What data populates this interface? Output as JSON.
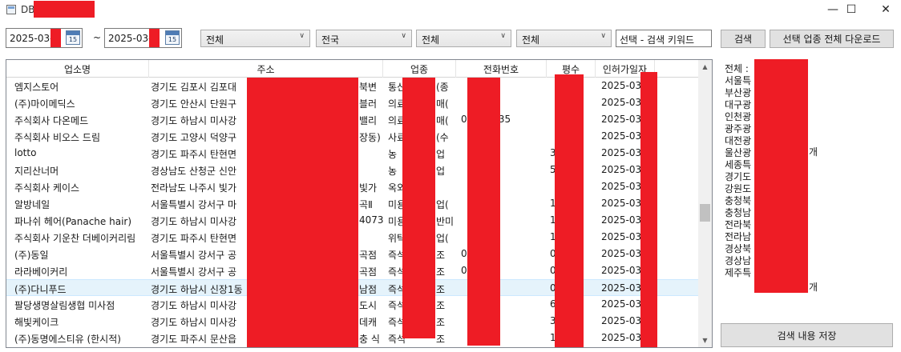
{
  "window": {
    "title": "DB",
    "minimize_glyph": "—",
    "maximize_glyph": "☐",
    "close_glyph": "✕"
  },
  "filters": {
    "date_from": "2025-03-",
    "date_to": "2025-03-",
    "date_separator": "~",
    "calendar_day": "15",
    "combo1": "전체",
    "combo2": "전국",
    "combo3": "전체",
    "combo4": "전체",
    "keyword": "선택 - 검색 키워드",
    "search_label": "검색",
    "download_label": "선택 업종 전체 다운로드"
  },
  "table": {
    "columns": [
      "업소명",
      "주소",
      "업종",
      "전화번호",
      "평수",
      "인허가일자"
    ],
    "rows": [
      {
        "name": "엠지스토어",
        "address": "경기도 김포시 김포대",
        "addr_tail": "북변",
        "type": "통신",
        "type_tail": "(종",
        "phone": "",
        "area": "",
        "date": "2025-03-"
      },
      {
        "name": "(주)마이메딕스",
        "address": "경기도 안산시 단원구",
        "addr_tail": "블러",
        "type": "의료",
        "type_tail": "매(",
        "phone": "",
        "area": "",
        "date": "2025-03-"
      },
      {
        "name": "주식회사 다온메드",
        "address": "경기도 하남시 미사강",
        "addr_tail": "밸리",
        "type": "의료",
        "type_tail": "매(",
        "phone": "02-7-6135",
        "area": "",
        "date": "2025-03-"
      },
      {
        "name": "주식회사 비오스 드림",
        "address": "경기도 고양시 덕양구",
        "addr_tail": "장동)",
        "type": "사료",
        "type_tail": "(수",
        "phone": "",
        "area": "",
        "date": "2025-03-"
      },
      {
        "name": "lotto",
        "address": "경기도 파주시 탄현면",
        "addr_tail": "",
        "type": "농",
        "type_tail": "업",
        "phone": "",
        "area": "3",
        "date": "2025-03-"
      },
      {
        "name": "지리산너머",
        "address": "경상남도 산청군 신안",
        "addr_tail": "",
        "type": "농",
        "type_tail": "업",
        "phone": "",
        "area": "5",
        "date": "2025-03-"
      },
      {
        "name": "주식회사 케이스",
        "address": "전라남도 나주시 빛가",
        "addr_tail": "빛가",
        "type": "옥외",
        "type_tail": "",
        "phone": "",
        "area": "",
        "date": "2025-03-"
      },
      {
        "name": "알방네일",
        "address": "서울특별시 강서구 마",
        "addr_tail": "곡Ⅱ",
        "type": "미용",
        "type_tail": "업(",
        "phone": "",
        "area": "1",
        "date": "2025-03-"
      },
      {
        "name": "파나쉬 헤어(Panache hair)",
        "address": "경기도 하남시 미사강",
        "addr_tail": "4073",
        "type": "미용",
        "type_tail": "반미",
        "phone": "",
        "area": "1",
        "date": "2025-03-"
      },
      {
        "name": "주식회사 기운찬 더베이커리림",
        "address": "경기도 파주시 탄현면",
        "addr_tail": "",
        "type": "위탁",
        "type_tail": "업(",
        "phone": "",
        "area": "1",
        "date": "2025-03-"
      },
      {
        "name": "(주)동일",
        "address": "서울특별시 강서구 공",
        "addr_tail": "곡점",
        "type": "즉석",
        "type_tail": "조",
        "phone": "02-826",
        "area": "0",
        "date": "2025-03-"
      },
      {
        "name": "라라베이커리",
        "address": "서울특별시 강서구 공",
        "addr_tail": "곡점",
        "type": "즉석",
        "type_tail": "조",
        "phone": "02-713",
        "area": "0",
        "date": "2025-03-"
      },
      {
        "name": "(주)다니푸드",
        "address": "경기도 하남시 신장1동",
        "addr_tail": "남점",
        "type": "즉석",
        "type_tail": "조",
        "phone": "",
        "area": "0",
        "date": "2025-03-"
      },
      {
        "name": "팔당생명살림생협 미사점",
        "address": "경기도 하남시 미사강",
        "addr_tail": "도시",
        "type": "즉석",
        "type_tail": "조",
        "phone": "",
        "area": "6",
        "date": "2025-03-"
      },
      {
        "name": "해빛케이크",
        "address": "경기도 하남시 미사강",
        "addr_tail": "데캐",
        "type": "즉석",
        "type_tail": "조",
        "phone": "",
        "area": "3",
        "date": "2025-03-"
      },
      {
        "name": "(주)동명에스티유 (한시적)",
        "address": "경기도 파주시 문산읍",
        "addr_tail": "충 식",
        "type": "즉석",
        "type_tail": "조",
        "phone": "",
        "area": "1",
        "date": "2025-03-"
      }
    ]
  },
  "stats": {
    "lines": [
      "전체 :",
      "서울특",
      "부산광",
      "대구광",
      "인천광",
      "광주광",
      "대전광",
      "울산광",
      "세종특",
      "경기도",
      "강원도",
      "충청북",
      "충청남",
      "전라북",
      "전라남",
      "경상북",
      "경상남",
      "제주특"
    ],
    "suffix_seoul": "개",
    "suffix_jeju": "개"
  },
  "save_label": "검색 내용 저장",
  "colors": {
    "redaction": "#ee1c25",
    "selected_row": "#e5f3fb",
    "button_face": "#e1e1e1"
  }
}
